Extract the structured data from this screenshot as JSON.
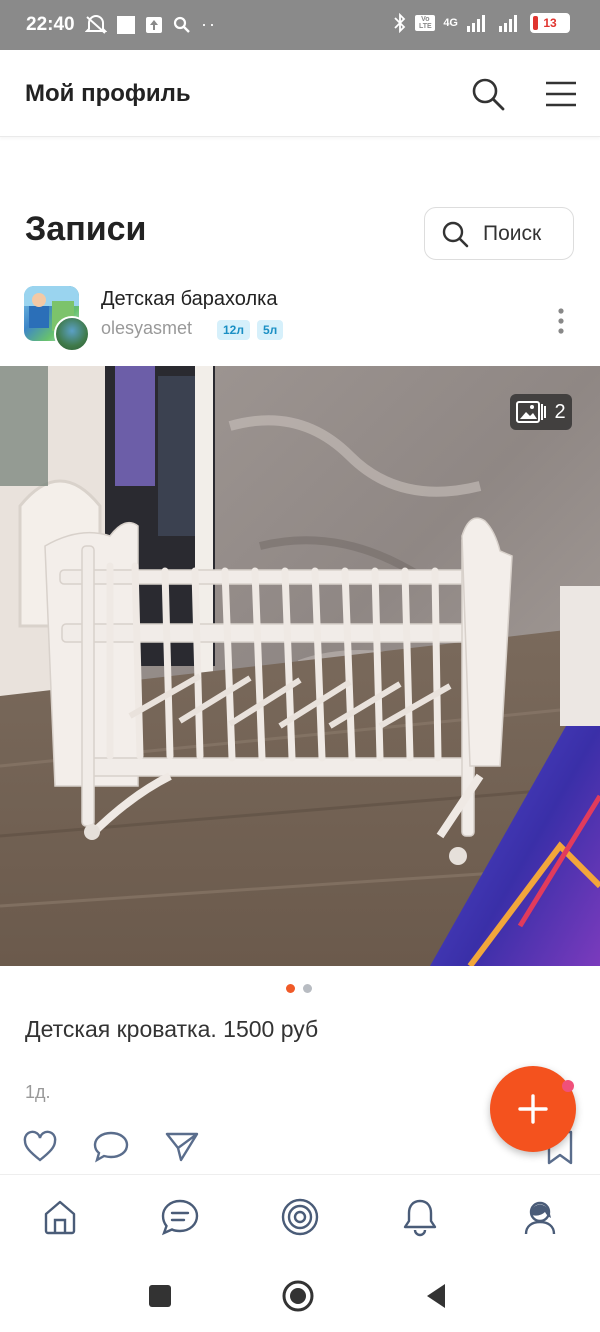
{
  "status_bar": {
    "time": "22:40",
    "network": "4G",
    "battery": "13"
  },
  "header": {
    "title": "Мой профиль"
  },
  "records": {
    "title": "Записи",
    "search_label": "Поиск"
  },
  "post": {
    "group_name": "Детская барахолка",
    "author": "olesyasmet",
    "badges": [
      "12л",
      "5л"
    ],
    "photo_count": "2",
    "text": "Детская кроватка. 1500 руб",
    "time": "1д."
  },
  "icons": {
    "like": "heart-icon",
    "comment": "comment-icon",
    "share": "send-icon",
    "bookmark": "bookmark-icon",
    "add": "plus-icon"
  },
  "tabs": [
    "home-icon",
    "messages-icon",
    "discover-icon",
    "notifications-icon",
    "profile-icon"
  ],
  "colors": {
    "accent": "#f4521e",
    "badge_bg": "#d6f0fb",
    "badge_text": "#1a8fc4",
    "tab_icon": "#4a5c78"
  }
}
